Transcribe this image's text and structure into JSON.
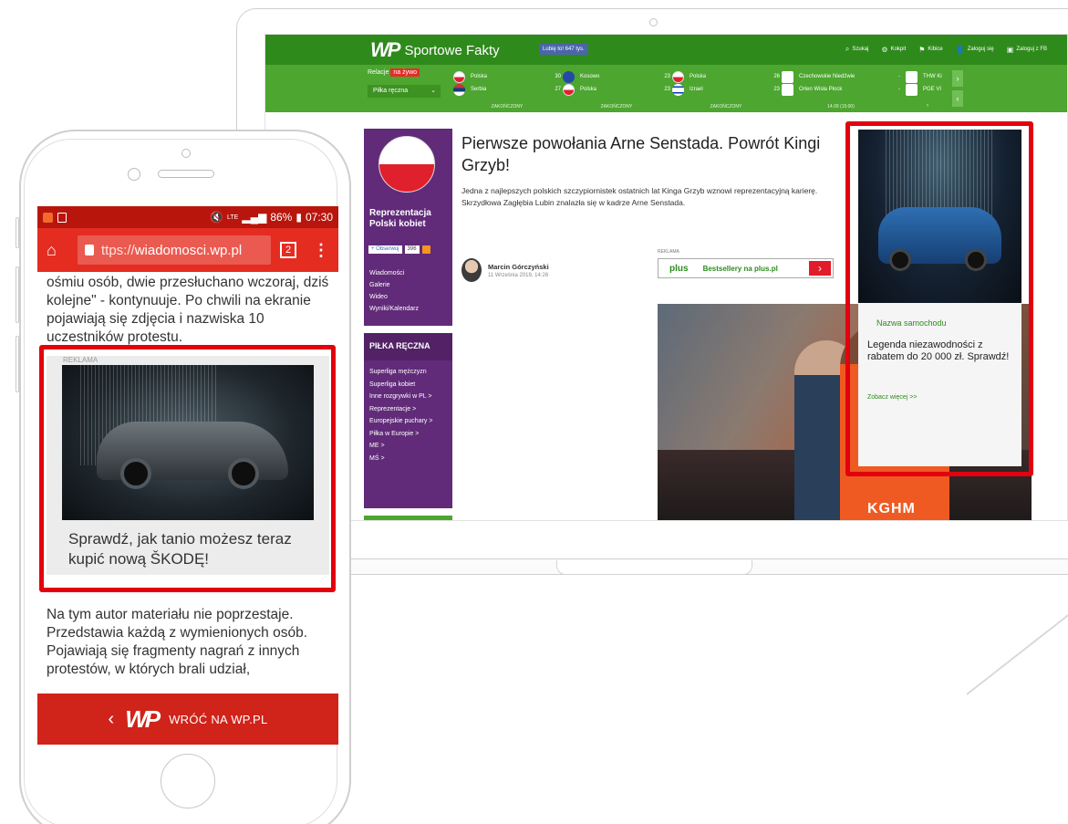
{
  "site": {
    "logo_mark": "WP",
    "logo_name": "Sportowe Fakty",
    "fb_like": "Lubię to! 647 tys.",
    "top_links": [
      {
        "icon": "search-icon",
        "label": "Szukaj"
      },
      {
        "icon": "gear-icon",
        "label": "Kokpit"
      },
      {
        "icon": "flag-icon",
        "label": "Kibice"
      },
      {
        "icon": "user-icon",
        "label": "Zaloguj się"
      },
      {
        "icon": "facebook-icon",
        "label": "Zaloguj z FB"
      }
    ],
    "live": {
      "label": "Relacje",
      "badge": "na żywo",
      "sport": "Piłka ręczna"
    },
    "matches": [
      {
        "home": "Polska",
        "home_score": "30",
        "away": "Serbia",
        "away_score": "27",
        "status": "ZAKOŃCZONY"
      },
      {
        "home": "Kosowo",
        "home_score": "23",
        "away": "Polska",
        "away_score": "23",
        "status": "ZAKOŃCZONY"
      },
      {
        "home": "Polska",
        "home_score": "26",
        "away": "Izrael",
        "away_score": "23",
        "status": "ZAKOŃCZONY"
      },
      {
        "home": "Czechowskie Niedźwie",
        "home_score": "-",
        "away": "Orlen Wisła Płock",
        "away_score": "-",
        "status": "14.09 (15:00)"
      },
      {
        "home": "THW Ki",
        "home_score": "",
        "away": "PGE VI",
        "away_score": "",
        "status": "1"
      }
    ],
    "sidebar": {
      "promo_title": "Reprezentacja Polski kobiet",
      "follow": "+ Obserwuj",
      "follow_count": "396",
      "promo_links": [
        "Wiadomości",
        "Galerie",
        "Wideo",
        "Wyniki/Kalendarz"
      ],
      "section_title": "PIŁKA RĘCZNA",
      "section_links": [
        "Superliga mężczyzn",
        "Superliga kobiet",
        "Inne rozgrywki w PL >",
        "Reprezentacje >",
        "Europejskie puchary >",
        "Piłka w Europie >",
        "ME >",
        "MŚ >"
      ]
    },
    "article": {
      "title": "Pierwsze powołania Arne Senstada. Powrót Kingi Grzyb!",
      "lead": "Jedna z najlepszych polskich szczypiornistek ostatnich lat Kinga Grzyb wznowi reprezentacyjną karierę. Skrzydłowa Zagłębia Lubin znalazła się w kadrze Arne Senstada.",
      "author": "Marcin Górczyński",
      "date": "11 Września 2019, 14:26",
      "ad_label": "REKLAMA",
      "ad_brand": "plus",
      "ad_text": "Bestsellery na plus.pl",
      "photo_sponsor": "KGHM"
    },
    "side_ad": {
      "model": "Nazwa samochodu",
      "desc": "Legenda niezawodności z rabatem do 20 000 zł. Sprawdź!",
      "more": "Zobacz więcej >>"
    }
  },
  "phone": {
    "time": "07:30",
    "battery": "86%",
    "network": "LTE",
    "url_prefix": "ttps://",
    "url_host": "wiadomosci.wp.pl",
    "tabs": "2",
    "text_before": "ośmiu osób, dwie przesłuchano wczoraj, dziś kolejne\" - kontynuuje. Po chwili na ekranie pojawiają się zdjęcia i nazwiska 10 uczestników protestu.",
    "ad_label": "REKLAMA",
    "ad_cta": "Sprawdź, jak tanio możesz teraz kupić nową ŠKODĘ!",
    "text_after": "Na tym autor materiału nie poprzestaje. Przedstawia każdą z wymienionych osób. Pojawiają się fragmenty nagrań z innych protestów, w których brali udział,",
    "back_logo": "WP",
    "back_label": "WRÓĆ NA WP.PL"
  },
  "colors": {
    "highlight": "#e3000f",
    "site_green": "#4ca62f",
    "wp_red": "#e42c21",
    "sidebar_purple": "#612b79"
  }
}
